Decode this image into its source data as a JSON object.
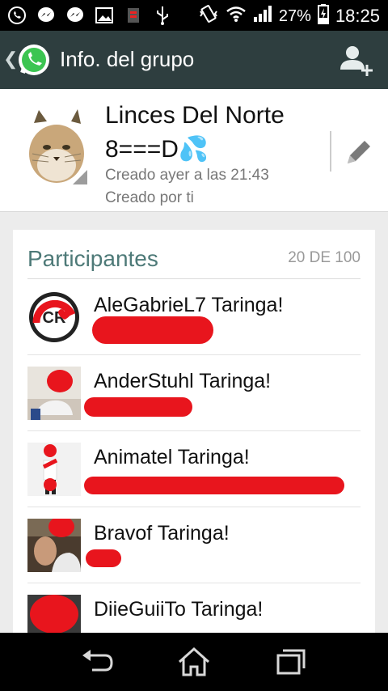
{
  "status_bar": {
    "battery": "27%",
    "time": "18:25",
    "left_icons": [
      "whatsapp-notification-icon",
      "messenger-icon",
      "messenger-icon",
      "image-icon",
      "sim-icon",
      "usb-icon"
    ],
    "right_icons": [
      "vibrate-icon",
      "wifi-icon",
      "signal-icon",
      "battery-charging-icon"
    ]
  },
  "action_bar": {
    "title": "Info. del grupo",
    "back_glyph": "❮"
  },
  "group": {
    "name": "Linces Del Norte 8===D💦",
    "created_when": "Creado ayer a las 21:43",
    "created_by": "Creado por ti"
  },
  "participants": {
    "heading": "Participantes",
    "count": "20 DE 100",
    "items": [
      {
        "name": "AleGabrieL7 Taringa!"
      },
      {
        "name": "AnderStuhl Taringa!"
      },
      {
        "name": "Animatel Taringa!"
      },
      {
        "name": "Bravof Taringa!"
      },
      {
        "name": "DiieGuiiTo Taringa!"
      }
    ]
  },
  "colors": {
    "action_bar": "#2e3e3f",
    "accent_teal": "#4e7a78",
    "redaction": "#e8151d"
  }
}
